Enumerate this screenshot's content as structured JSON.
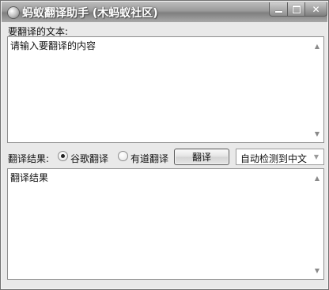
{
  "window": {
    "title": "蚂蚁翻译助手 (木蚂蚁社区)",
    "minimize_icon": "minimize-icon",
    "maximize_icon": "maximize-icon",
    "close_icon": "close-icon"
  },
  "input_section": {
    "label": "要翻译的文本:",
    "placeholder_text": "请输入要翻译的内容"
  },
  "controls": {
    "result_label": "翻译结果:",
    "engines": [
      {
        "label": "谷歌翻译",
        "selected": true
      },
      {
        "label": "有道翻译",
        "selected": false
      }
    ],
    "translate_button": "翻译",
    "language_select": {
      "value": "自动检测到中文"
    }
  },
  "output_section": {
    "text": "翻译结果"
  },
  "colors": {
    "window_bg": "#e9e9e9",
    "title_text": "#ffffff"
  }
}
